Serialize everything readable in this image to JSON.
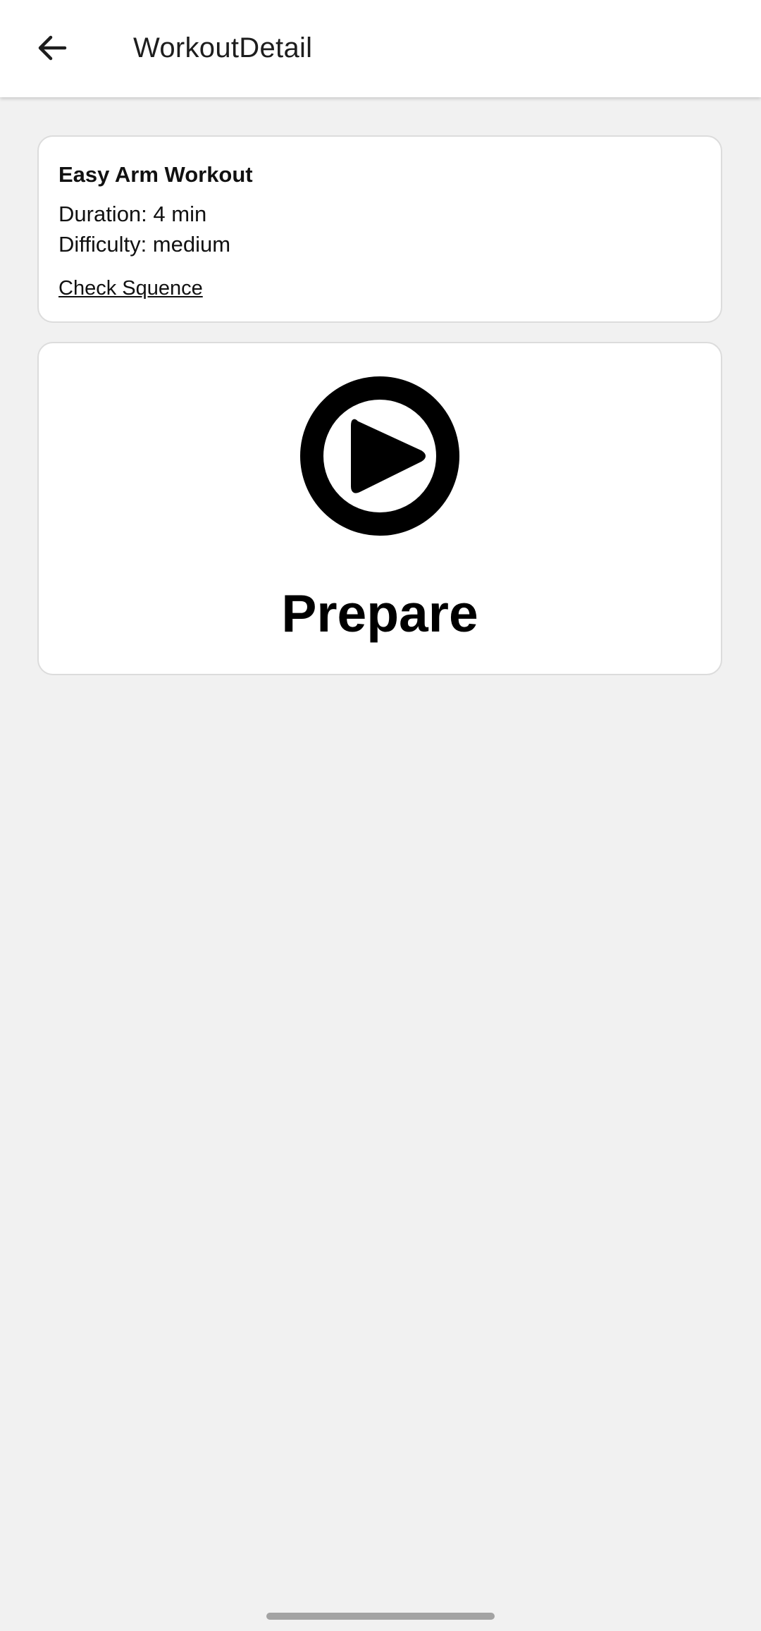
{
  "app_bar": {
    "title": "WorkoutDetail",
    "back_icon": "arrow-left-icon"
  },
  "workout": {
    "name": "Easy Arm Workout",
    "duration": "Duration: 4 min",
    "difficulty": "Difficulty: medium",
    "sequence_link": "Check Squence"
  },
  "prepare": {
    "icon": "play-circle-icon",
    "label": "Prepare"
  },
  "colors": {
    "background": "#f1f1f1",
    "card": "#ffffff",
    "text": "#111111"
  }
}
